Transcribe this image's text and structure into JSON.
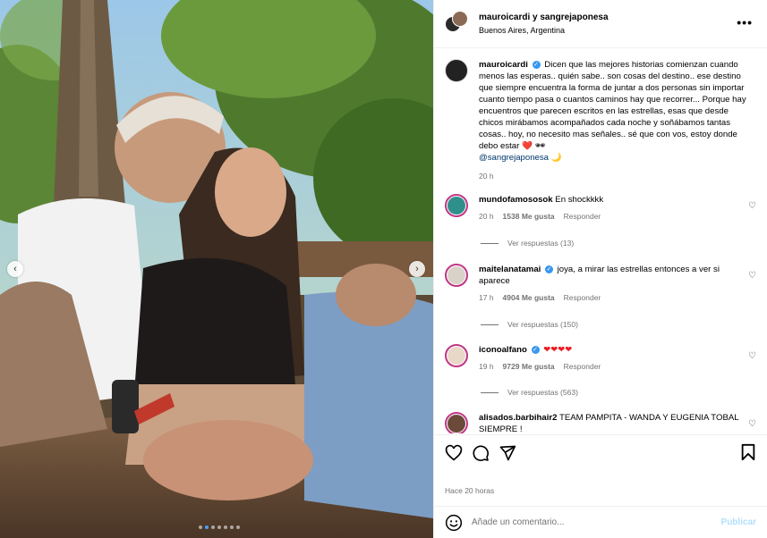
{
  "post": {
    "header": {
      "names": "mauroicardi y sangrejaponesa",
      "location": "Buenos Aires, Argentina",
      "more_icon": "more-horizontal-icon"
    },
    "caption": {
      "username": "mauroicardi",
      "verified": true,
      "text": "Dicen que las mejores historias comienzan cuando menos las esperas.. quién sabe.. son cosas del destino.. ese destino que siempre encuentra la forma de juntar a dos personas sin importar cuanto tiempo pasa o cuantos caminos hay que recorrer... Porque hay encuentros que parecen escritos en las estrellas, esas que desde chicos mirábamos acompañados cada noche y soñábamos tantas cosas.. hoy, no necesito mas señales.. sé que con vos, estoy donde debo estar ❤️ 🕶",
      "mention": "@sangrejaponesa",
      "trail": "🌙",
      "time": "20 h"
    },
    "comments": [
      {
        "username": "mundofamososok",
        "verified": false,
        "text": "En shockkkk",
        "time": "20 h",
        "likes": "1538 Me gusta",
        "reply": "Responder",
        "view_replies": "Ver respuestas (13)"
      },
      {
        "username": "maitelanatamai",
        "verified": true,
        "text": "joya, a mirar las estrellas entonces a ver si aparece",
        "time": "17 h",
        "likes": "4904 Me gusta",
        "reply": "Responder",
        "view_replies": "Ver respuestas (150)"
      },
      {
        "username": "iconoalfano",
        "verified": true,
        "text": "❤❤❤❤",
        "time": "19 h",
        "likes": "9729 Me gusta",
        "reply": "Responder",
        "view_replies": "Ver respuestas (563)"
      },
      {
        "username": "alisados.barbihair2",
        "verified": false,
        "text": "TEAM PAMPITA - WANDA Y EUGENIA TOBAL SIEMPRE !"
      }
    ],
    "timestamp": "Hace 20 horas",
    "add_comment": {
      "placeholder": "Añade un comentario...",
      "post_label": "Publicar"
    },
    "carousel": {
      "slides": 7,
      "active_index": 1
    }
  },
  "colors": {
    "verified": "#3897f0",
    "muted": "#737373",
    "link": "#00376b",
    "post_disabled": "#b2dffc",
    "story_ring": "#c13584"
  }
}
